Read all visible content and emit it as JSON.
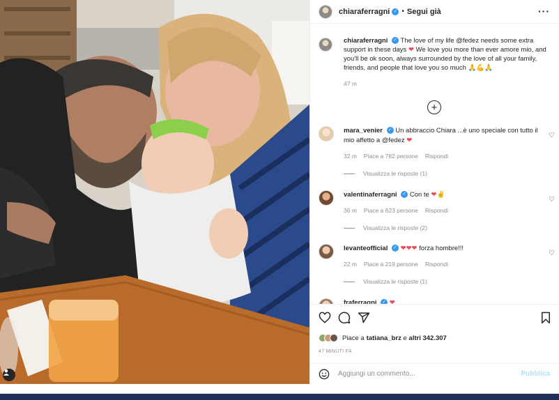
{
  "colors": {
    "accent": "#3897f0",
    "heart": "#ed4956",
    "muted": "#8e8e8e",
    "bottom_stripe": "#1f3158"
  },
  "header": {
    "username": "chiaraferragni",
    "separator": "•",
    "follow_label": "Segui già",
    "more_label": "···"
  },
  "caption": {
    "username": "chiaraferragni",
    "text_1": "The love of my life @fedez needs some extra support in these days",
    "text_2": "We love you more than ever amore mio, and you'll be ok soon, always surrounded by the love of all your family, friends, and people that love you so much",
    "emoji_end": "🙏💪🙏",
    "heart": "❤",
    "time": "47 m"
  },
  "load_more_label": "+",
  "comments": [
    {
      "username": "mara_venier",
      "verified": true,
      "text": "Un abbraccio Chiara ...è uno speciale con tutto il mio affetto a @fedez",
      "emoji": "❤",
      "time": "32 m",
      "likes": "Piace a 782 persone",
      "reply": "Rispondi",
      "view_replies": "Visualizza le risposte (1)"
    },
    {
      "username": "valentinaferragni",
      "verified": true,
      "text": "Con te",
      "emoji": "❤✌",
      "time": "36 m",
      "likes": "Piace a 623 persone",
      "reply": "Rispondi",
      "view_replies": "Visualizza le risposte (2)"
    },
    {
      "username": "levanteofficial",
      "verified": true,
      "text": "forza hombre!!!",
      "emoji": "❤❤❤",
      "time": "22 m",
      "likes": "Piace a 219 persone",
      "reply": "Rispondi",
      "view_replies": "Visualizza le risposte (1)"
    },
    {
      "username": "fraferragni",
      "verified": true,
      "text": "",
      "emoji": "❤",
      "time": "",
      "likes": "",
      "reply": "",
      "view_replies": ""
    }
  ],
  "actions": {
    "like_icon": "heart-icon",
    "comment_icon": "comment-icon",
    "share_icon": "share-icon",
    "save_icon": "bookmark-icon"
  },
  "likes": {
    "prefix": "Piace a ",
    "user": "tatiana_brz",
    "middle": " e ",
    "others": "altri 342.307"
  },
  "post_time": "47 MINUTI FA",
  "add_comment": {
    "placeholder": "Aggiungi un commento...",
    "publish_label": "Pubblica"
  }
}
